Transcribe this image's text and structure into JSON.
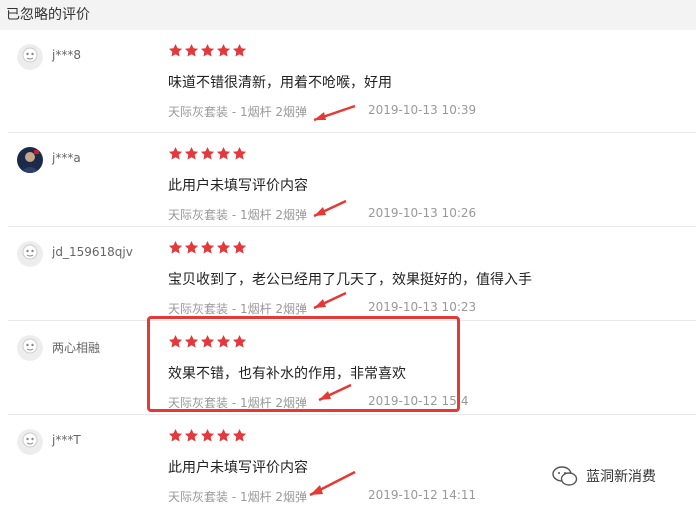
{
  "header": {
    "title": "已忽略的评价"
  },
  "reviews": [
    {
      "user": "j***8",
      "rating": 5,
      "text": "味道不错很清新，用着不呛喉，好用",
      "product": "天际灰套装 - 1烟杆 2烟弹",
      "date": "2019-10-13 10:39",
      "avatar": "default-avatar"
    },
    {
      "user": "j***a",
      "rating": 5,
      "text": "此用户未填写评价内容",
      "product": "天际灰套装 - 1烟杆 2烟弹",
      "date": "2019-10-13 10:26",
      "avatar": "photo-avatar"
    },
    {
      "user": "jd_159618qjv",
      "rating": 5,
      "text": "宝贝收到了，老公已经用了几天了，效果挺好的，值得入手",
      "product": "天际灰套装 - 1烟杆 2烟弹",
      "date": "2019-10-13 10:23",
      "avatar": "default-avatar"
    },
    {
      "user": "两心相融",
      "rating": 5,
      "text": "效果不错，也有补水的作用，非常喜欢",
      "product": "天际灰套装 - 1烟杆 2烟弹",
      "date": "2019-10-12 15:4",
      "avatar": "default-avatar"
    },
    {
      "user": "j***T",
      "rating": 5,
      "text": "此用户未填写评价内容",
      "product": "天际灰套装 - 1烟杆 2烟弹",
      "date": "2019-10-12 14:11",
      "avatar": "default-avatar"
    }
  ],
  "watermark": {
    "text": "蓝洞新消费"
  },
  "colors": {
    "star": "#e4393c",
    "annotation": "#e53935"
  }
}
